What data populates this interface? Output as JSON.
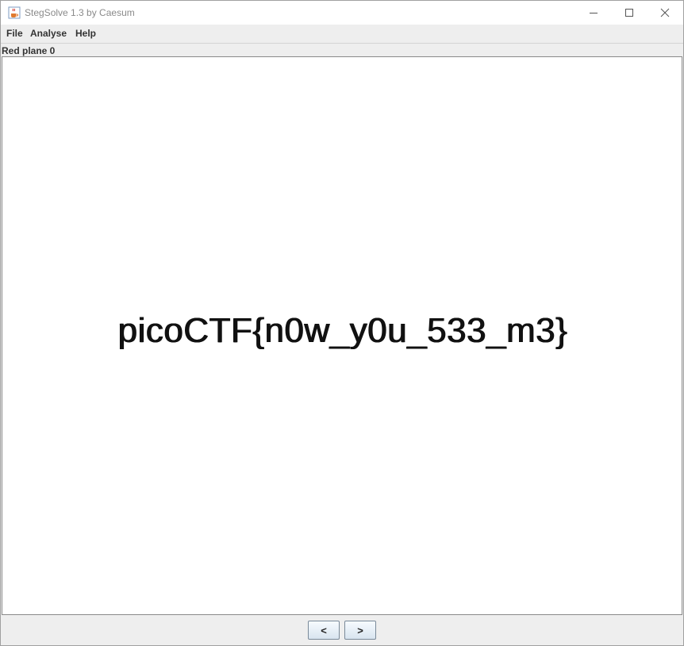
{
  "window": {
    "title": "StegSolve 1.3 by Caesum"
  },
  "menu": {
    "items": [
      {
        "label": "File"
      },
      {
        "label": "Analyse"
      },
      {
        "label": "Help"
      }
    ]
  },
  "view": {
    "plane_label": "Red plane 0",
    "image_text": "picoCTF{n0w_y0u_533_m3}"
  },
  "navigation": {
    "prev_label": "<",
    "next_label": ">"
  },
  "icons": {
    "app": "java-cup-icon",
    "minimize": "minimize-icon",
    "maximize": "maximize-icon",
    "close": "close-icon"
  },
  "colors": {
    "button_border": "#7a8a99",
    "window_bg": "#eeeeee"
  }
}
